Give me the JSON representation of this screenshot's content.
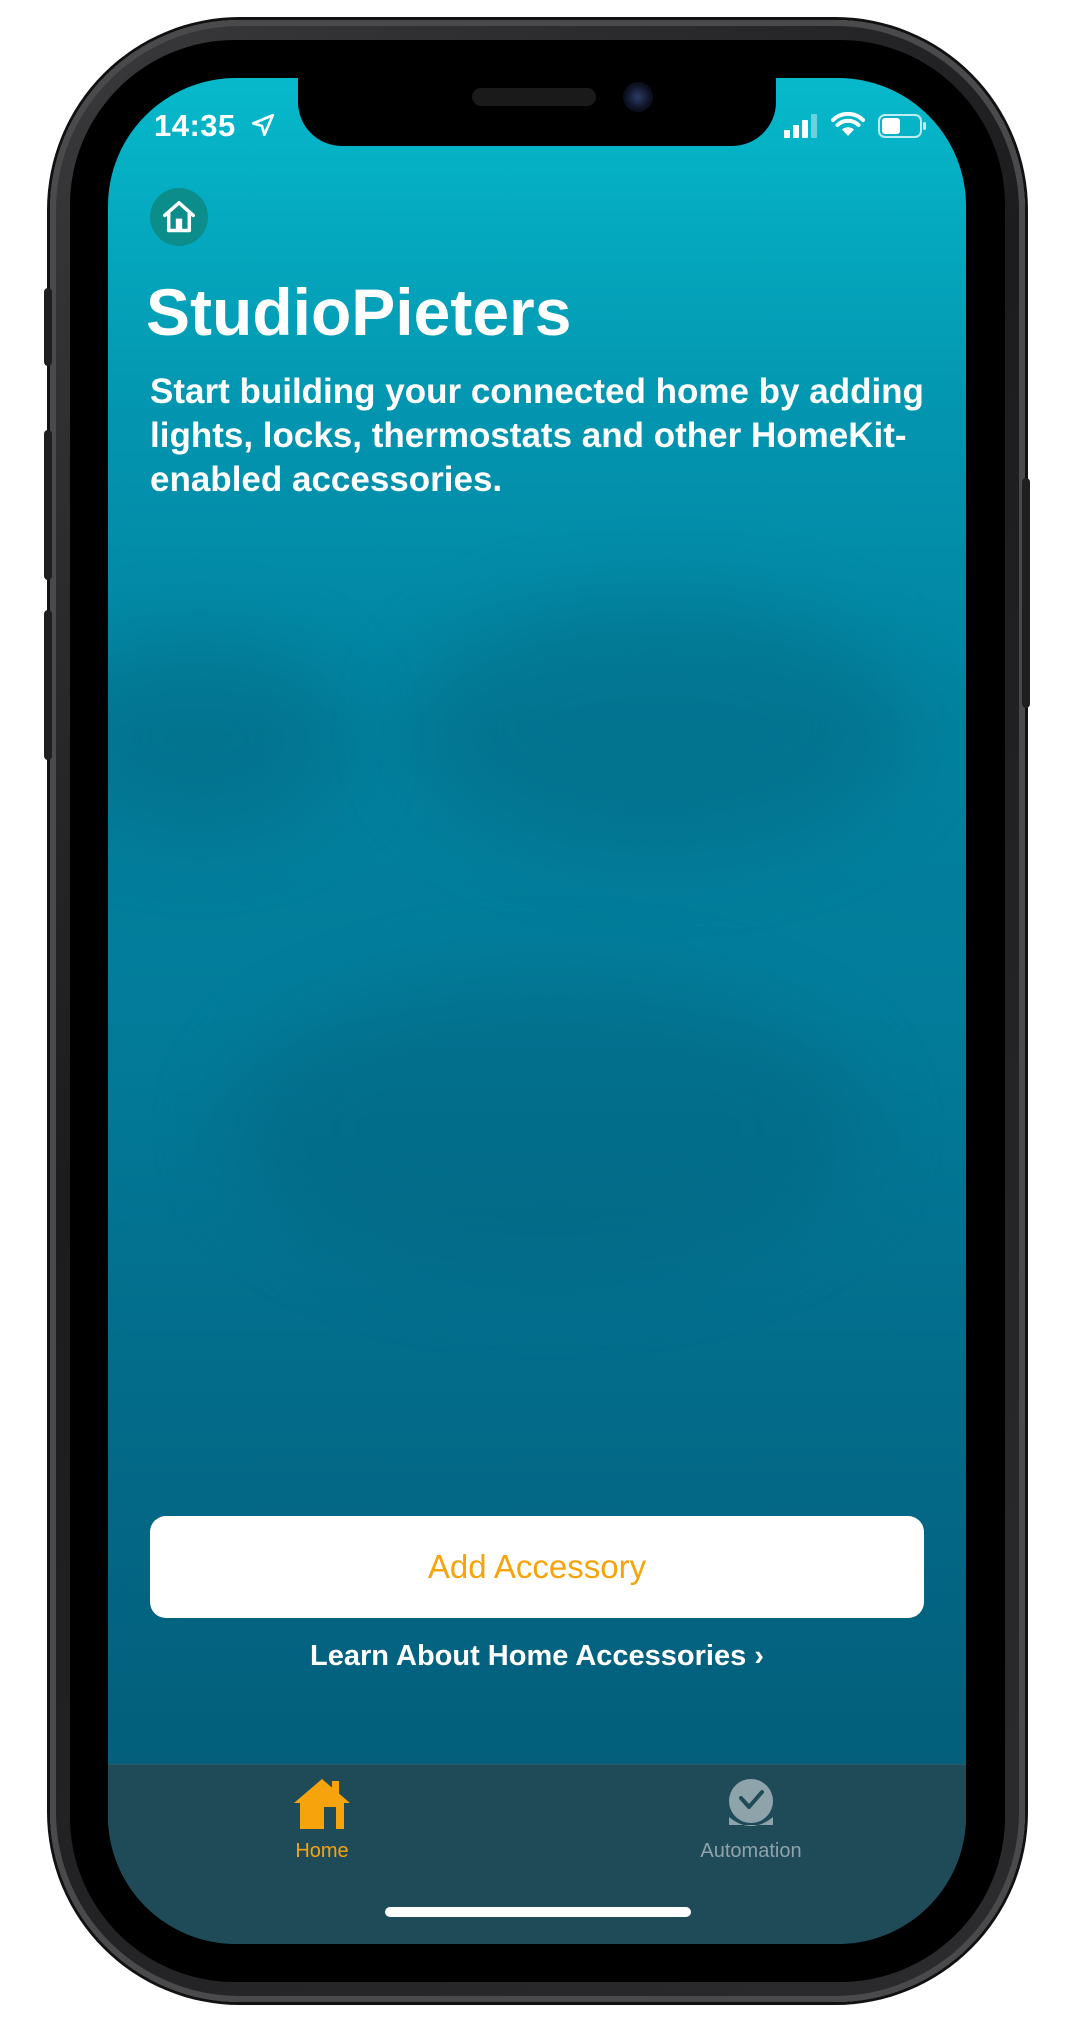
{
  "status_bar": {
    "time": "14:35",
    "icons": [
      "location-arrow-icon",
      "cellular-signal-icon",
      "wifi-icon",
      "battery-icon"
    ]
  },
  "header": {
    "home_icon": "home-icon",
    "title": "StudioPieters",
    "description": "Start building your connected home by adding lights, locks, thermostats and other HomeKit-enabled accessories."
  },
  "actions": {
    "add_accessory_label": "Add Accessory",
    "learn_more_label": "Learn About Home Accessories",
    "learn_more_chevron": "›"
  },
  "tab_bar": {
    "tabs": [
      {
        "label": "Home",
        "icon": "house-icon",
        "selected": true
      },
      {
        "label": "Automation",
        "icon": "clock-check-icon",
        "selected": false
      }
    ]
  },
  "colors": {
    "accent": "#f7a40c",
    "background_top": "#06b9cb",
    "background_bottom": "#045a75",
    "tab_bar": "#1f4b59",
    "inactive_tab": "#8fa3ab"
  }
}
